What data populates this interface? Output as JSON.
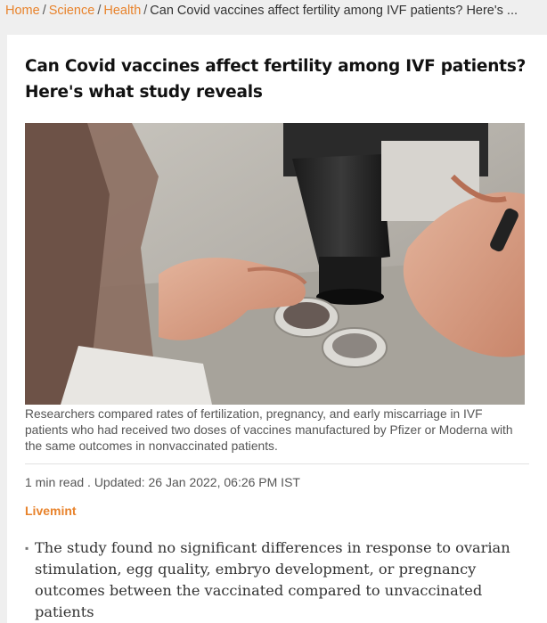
{
  "breadcrumb": {
    "home": "Home",
    "science": "Science",
    "health": "Health",
    "current": "Can Covid vaccines affect fertility among IVF patients? Here's ..."
  },
  "article": {
    "headline": "Can Covid vaccines affect fertility among IVF patients? Here's what study reveals",
    "caption": "Researchers compared rates of fertilization, pregnancy, and early miscarriage in IVF patients who had received two doses of vaccines manufactured by Pfizer or Moderna with the same outcomes in nonvaccinated patients.",
    "meta": "1 min read . Updated: 26 Jan 2022, 06:26 PM IST",
    "source": "Livemint",
    "summary": [
      "The study found no significant differences in response to ovarian stimulation, egg quality, embryo development, or pregnancy outcomes between the vaccinated compared to unvaccinated patients"
    ]
  },
  "colors": {
    "accent": "#e8832c",
    "page_bg": "#efefef",
    "card_bg": "#ffffff"
  }
}
